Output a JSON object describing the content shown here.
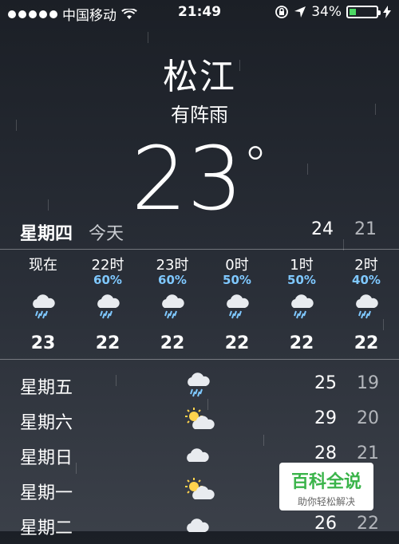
{
  "status": {
    "carrier": "中国移动",
    "time": "21:49",
    "battery": "34%",
    "battery_level": 0.34
  },
  "location": {
    "city": "松江",
    "condition": "有阵雨",
    "temperature": "23",
    "degree_symbol": "°"
  },
  "today": {
    "day": "星期四",
    "label": "今天",
    "high": "24",
    "low": "21"
  },
  "hourly": [
    {
      "time": "现在",
      "pop": "",
      "temp": "23",
      "icon": "rain-cloud-icon"
    },
    {
      "time": "22时",
      "pop": "60%",
      "temp": "22",
      "icon": "rain-cloud-icon"
    },
    {
      "time": "23时",
      "pop": "60%",
      "temp": "22",
      "icon": "rain-cloud-icon"
    },
    {
      "time": "0时",
      "pop": "50%",
      "temp": "22",
      "icon": "rain-cloud-icon"
    },
    {
      "time": "1时",
      "pop": "50%",
      "temp": "22",
      "icon": "rain-cloud-icon"
    },
    {
      "time": "2时",
      "pop": "40%",
      "temp": "22",
      "icon": "rain-cloud-icon"
    }
  ],
  "daily": [
    {
      "day": "星期五",
      "high": "25",
      "low": "19",
      "icon": "rain-cloud-icon"
    },
    {
      "day": "星期六",
      "high": "29",
      "low": "20",
      "icon": "partly-sunny-icon"
    },
    {
      "day": "星期日",
      "high": "28",
      "low": "21",
      "icon": "cloud-icon"
    },
    {
      "day": "星期一",
      "high": "28",
      "low": "",
      "icon": "partly-sunny-icon"
    },
    {
      "day": "星期二",
      "high": "26",
      "low": "22",
      "icon": "cloud-icon"
    }
  ],
  "watermark": {
    "title": "百科全说",
    "subtitle": "助你轻松解决"
  },
  "colors": {
    "pop": "#7fc8ff",
    "battery_fill": "#4cd964",
    "watermark_green": "#3ab44a"
  }
}
